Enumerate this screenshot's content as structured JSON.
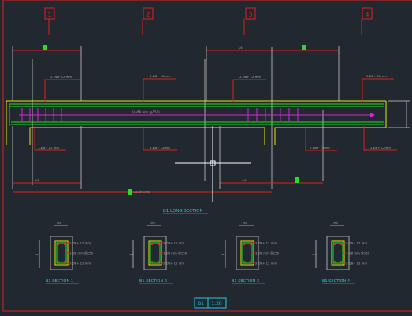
{
  "drawing": {
    "grid_axes": [
      "1",
      "2",
      "3",
      "4"
    ],
    "long_section": {
      "title": "B1 LONG SECTION",
      "stirrup_note": "(4-Ø6 mm @150)",
      "top_bar_labels": [
        "2-Ø8+ 12 mm",
        "2-Ø8+ 12mm",
        "2-Ø8+ 12 mm",
        "3-Ø8+ 12mm"
      ],
      "bottom_bar_labels": [
        "2-Ø8+ 12 mm",
        "2-Ø8+ 12mm",
        "2-Ø8+ 12mm",
        "2-Ø8+ 12mm"
      ],
      "span_labels": [
        "1/4",
        "1/4",
        "1/4",
        "1/4"
      ],
      "overall_span_label": "CLEAR SPAN"
    },
    "sections": [
      {
        "title": "B1 SECTION 1",
        "width": "250",
        "depth": "350",
        "top": "2-Ø8+ 12 mm",
        "stirrup": "1-Ø8 mm @150",
        "bottom": "2-Ø8+ 12 mm"
      },
      {
        "title": "B1 SECTION 2",
        "width": "250",
        "depth": "350",
        "top": "2-Ø8+ 12 mm",
        "stirrup": "1-Ø8 mm @150",
        "bottom": "2-Ø8+ 12 mm"
      },
      {
        "title": "B1 SECTION 3",
        "width": "250",
        "depth": "350",
        "top": "2-Ø8+ 12 mm",
        "stirrup": "1-Ø8 mm @150",
        "bottom": "2-Ø8+ 12 mm"
      },
      {
        "title": "B1 SECTION 4",
        "width": "250",
        "depth": "350",
        "top": "2-Ø8+ 12 mm",
        "stirrup": "1-Ø8 mm @150",
        "bottom": "2-Ø8+ 12 mm"
      }
    ],
    "title_block": {
      "name": "B1",
      "scale": "1:20"
    }
  },
  "colors": {
    "background": "#212830",
    "red": "#e02020",
    "green": "#24e024",
    "yellow": "#e8e800",
    "magenta": "#e020e0",
    "cyan": "#20c8e0",
    "grey": "#a8a8a8",
    "white": "#ffffff"
  }
}
